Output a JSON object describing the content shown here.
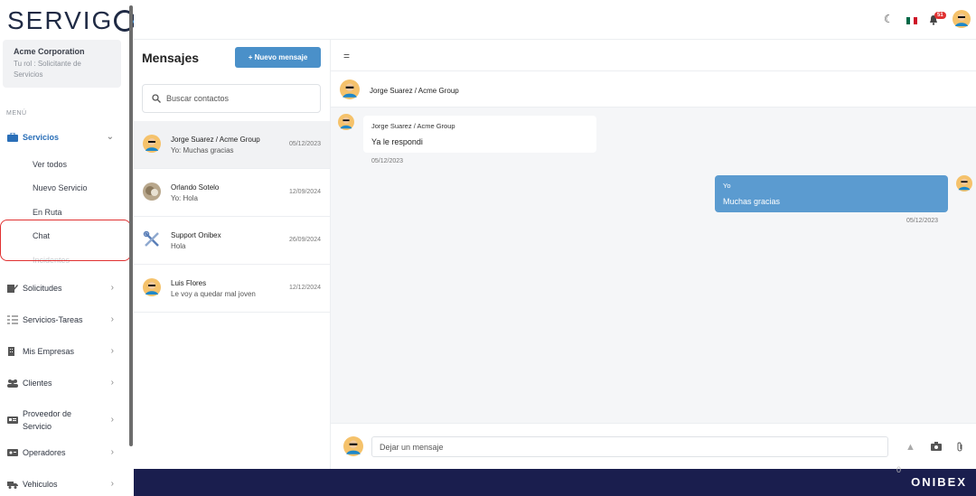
{
  "app": {
    "logo_text": "SERVI",
    "logo_suffix": "G"
  },
  "org": {
    "name": "Acme Corporation",
    "role": "Tu rol : Solicitante de Servicios"
  },
  "sidebar": {
    "menu_title": "MENÚ",
    "servicios": {
      "label": "Servicios",
      "icon": "briefcase-icon"
    },
    "sub_items": [
      "Ver todos",
      "Nuevo Servicio",
      "En Ruta",
      "Chat",
      "Incidentes"
    ],
    "items": [
      {
        "label": "Solicitudes",
        "icon": "edit-icon"
      },
      {
        "label": "Servicios-Tareas",
        "icon": "checklist-icon"
      },
      {
        "label": "Mis Empresas",
        "icon": "building-icon"
      },
      {
        "label": "Clientes",
        "icon": "users-icon"
      },
      {
        "label": "Proveedor de Servicio",
        "icon": "id-card-icon"
      },
      {
        "label": "Operadores",
        "icon": "id-badge-icon"
      },
      {
        "label": "Vehiculos",
        "icon": "truck-icon"
      }
    ]
  },
  "topbar": {
    "notification_count": "51",
    "icons": [
      "moon-icon",
      "mexico-flag-icon",
      "bell-icon",
      "avatar"
    ]
  },
  "contacts": {
    "title": "Mensajes",
    "new_button": "+ Nuevo mensaje",
    "search_placeholder": "Buscar contactos",
    "list": [
      {
        "name": "Jorge Suarez / Acme Group",
        "preview": "Yo: Muchas gracias",
        "date": "05/12/2023"
      },
      {
        "name": "Orlando Sotelo",
        "preview": "Yo: Hola",
        "date": "12/09/2024"
      },
      {
        "name": "Support Onibex",
        "preview": "Hola",
        "date": "26/09/2024"
      },
      {
        "name": "Luis Flores",
        "preview": "Le voy a quedar mal joven",
        "date": "12/12/2024"
      }
    ]
  },
  "chat": {
    "header_name": "Jorge Suarez / Acme Group",
    "messages": [
      {
        "sender": "Jorge Suarez / Acme Group",
        "text": "Ya le respondi",
        "date": "05/12/2023"
      },
      {
        "sender": "Yo",
        "text": "Muchas gracias",
        "date": "05/12/2023"
      }
    ],
    "input_placeholder": "Dejar un mensaje"
  },
  "footer": {
    "brand": "ONIBEX",
    "indicator": "0"
  },
  "colors": {
    "accent": "#4a90c9",
    "footer": "#1a1e4e",
    "highlight": "#e03131",
    "outgoing_bubble": "#5b9bd0"
  }
}
